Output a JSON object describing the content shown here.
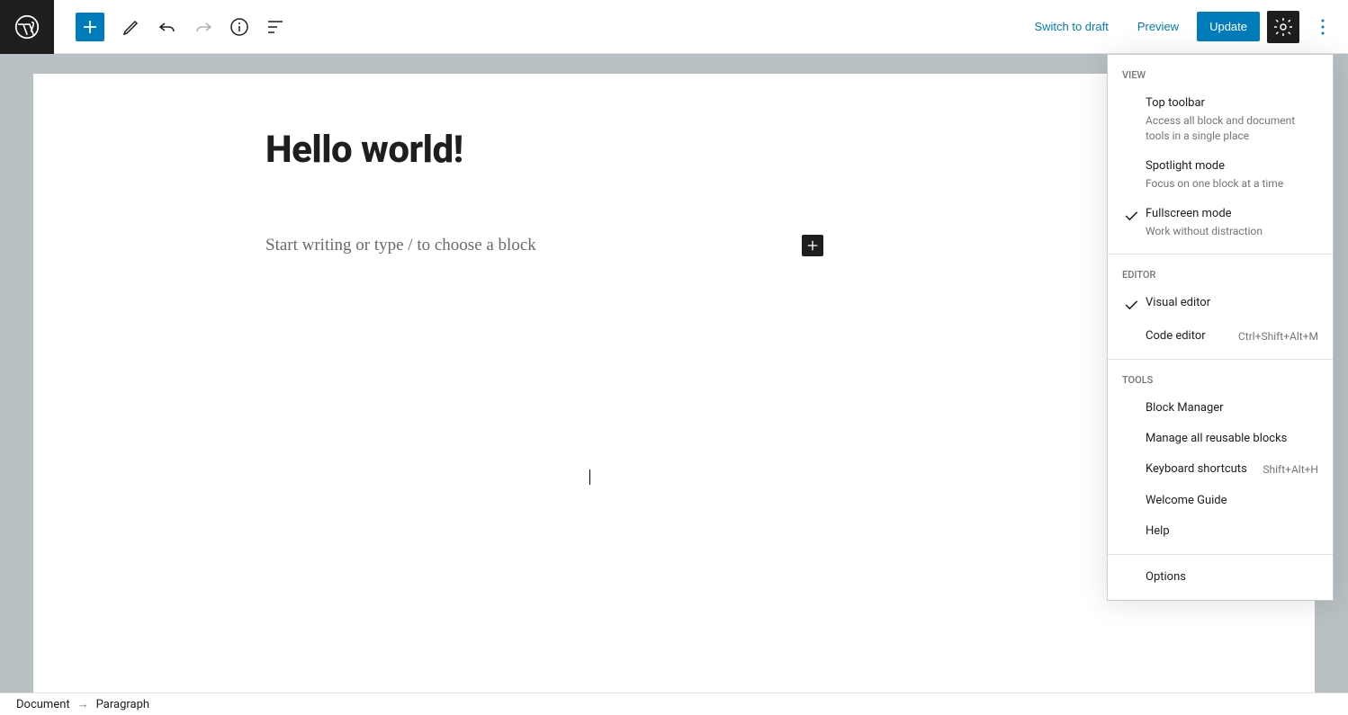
{
  "topbar": {
    "switch_to_draft": "Switch to draft",
    "preview": "Preview",
    "update": "Update"
  },
  "editor": {
    "title": "Hello world!",
    "placeholder": "Start writing or type / to choose a block"
  },
  "footer": {
    "root": "Document",
    "current": "Paragraph"
  },
  "dropdown": {
    "sections": {
      "view": {
        "label": "View",
        "top_toolbar": {
          "title": "Top toolbar",
          "desc": "Access all block and document tools in a single place"
        },
        "spotlight": {
          "title": "Spotlight mode",
          "desc": "Focus on one block at a time"
        },
        "fullscreen": {
          "title": "Fullscreen mode",
          "desc": "Work without distraction"
        }
      },
      "editor": {
        "label": "Editor",
        "visual": {
          "title": "Visual editor"
        },
        "code": {
          "title": "Code editor",
          "shortcut": "Ctrl+Shift+Alt+M"
        }
      },
      "tools": {
        "label": "Tools",
        "block_manager": "Block Manager",
        "reusable": "Manage all reusable blocks",
        "shortcuts": {
          "title": "Keyboard shortcuts",
          "shortcut": "Shift+Alt+H"
        },
        "welcome": "Welcome Guide",
        "help": "Help"
      },
      "options": "Options"
    }
  }
}
